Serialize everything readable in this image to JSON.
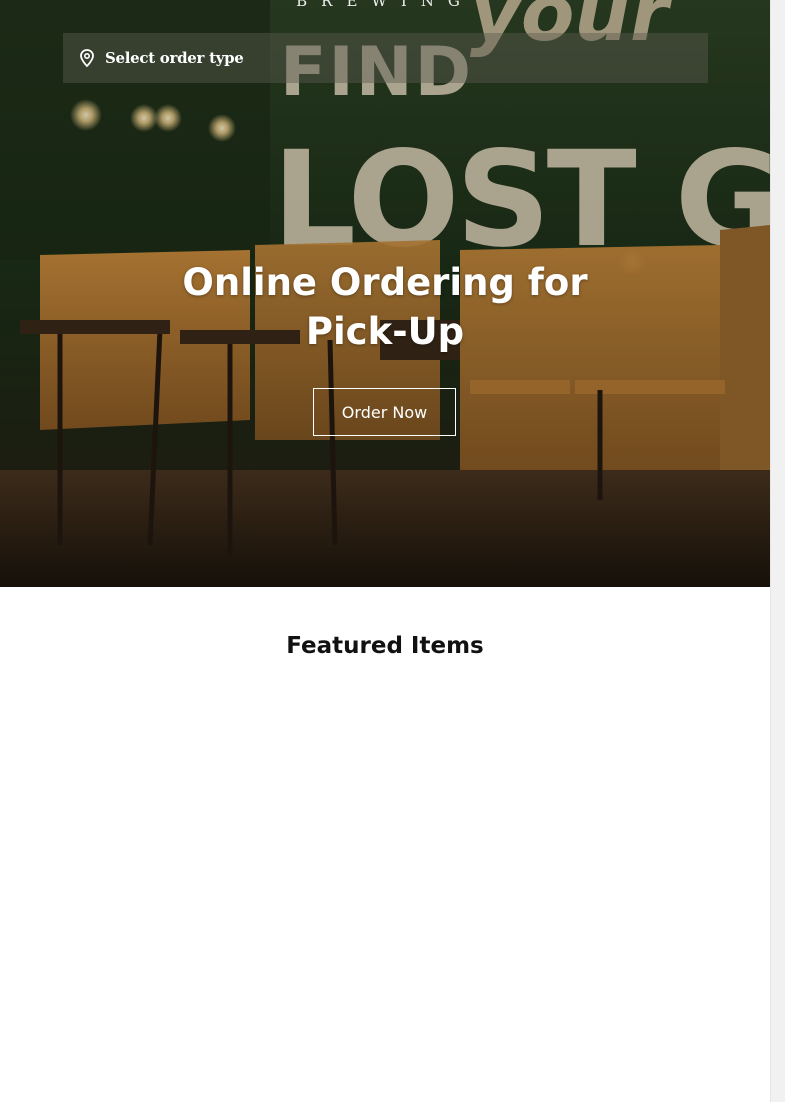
{
  "brand": {
    "subtitle": "BREWING"
  },
  "order_type": {
    "icon": "map-pin-icon",
    "label": "Select order type"
  },
  "hero": {
    "title": "Online Ordering for Pick-Up",
    "cta_label": "Order Now",
    "mural_text_1": "FIND",
    "mural_text_2": "your",
    "mural_text_3": "LOST GRO"
  },
  "featured": {
    "title": "Featured Items"
  },
  "colors": {
    "hero_overlay": "#2b2a1b",
    "mural_green": "#1f3a1e",
    "wood": "#b9752b",
    "text_white": "#ffffff",
    "heading_dark": "#111111"
  }
}
